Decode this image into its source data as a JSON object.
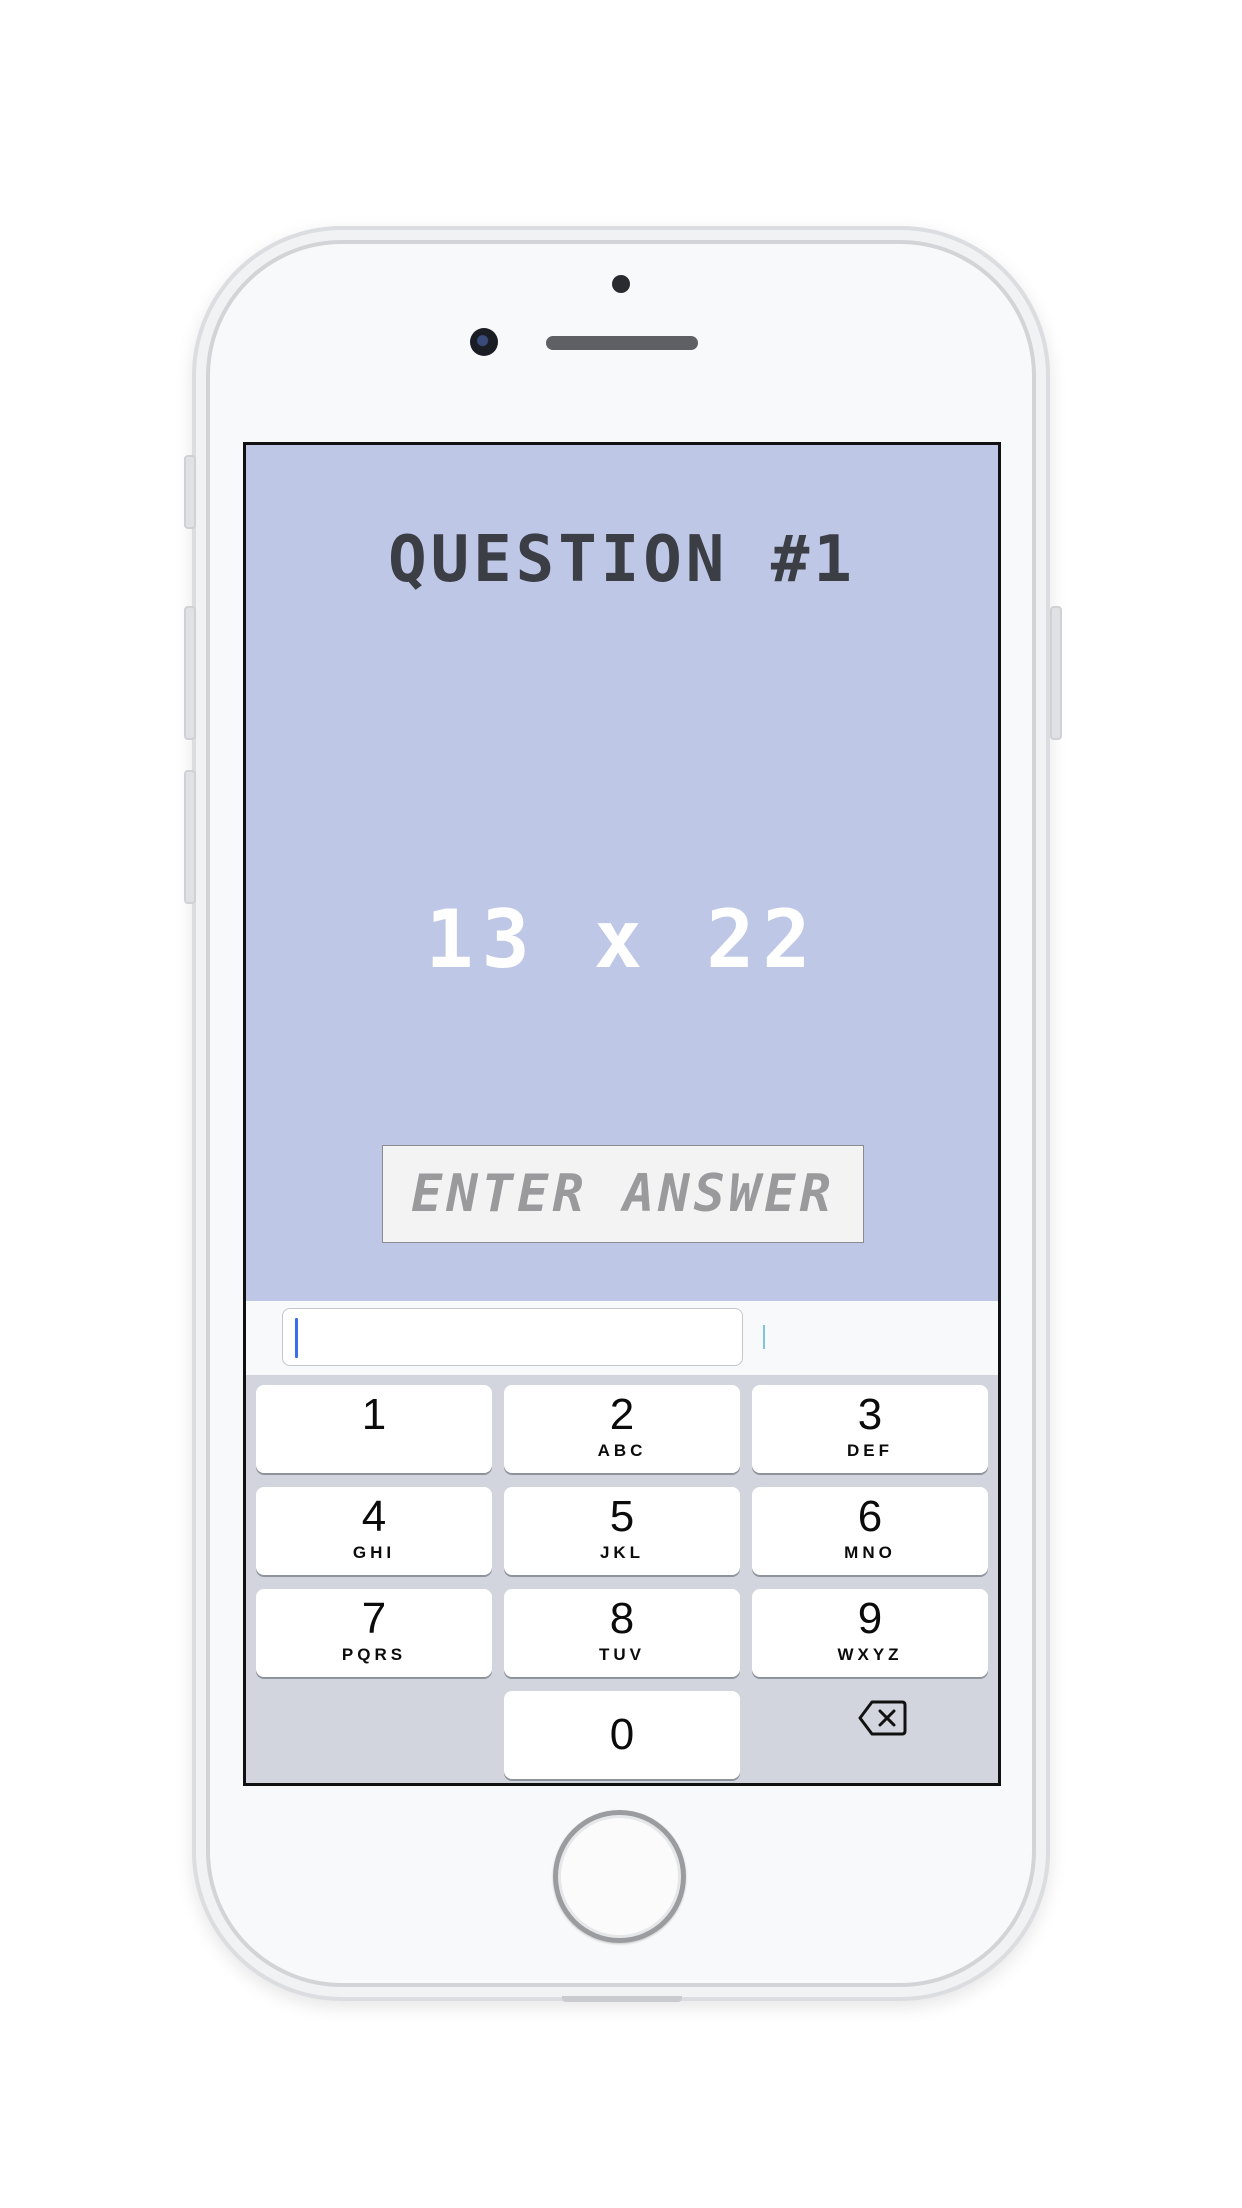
{
  "quiz": {
    "title": "QUESTION #1",
    "problem": "13 x 22",
    "answer_placeholder": "ENTER ANSWER"
  },
  "keypad": {
    "keys": [
      {
        "num": "1",
        "letters": ""
      },
      {
        "num": "2",
        "letters": "ABC"
      },
      {
        "num": "3",
        "letters": "DEF"
      },
      {
        "num": "4",
        "letters": "GHI"
      },
      {
        "num": "5",
        "letters": "JKL"
      },
      {
        "num": "6",
        "letters": "MNO"
      },
      {
        "num": "7",
        "letters": "PQRS"
      },
      {
        "num": "8",
        "letters": "TUV"
      },
      {
        "num": "9",
        "letters": "WXYZ"
      },
      {
        "num": "0",
        "letters": ""
      }
    ],
    "delete_icon": "backspace-icon"
  },
  "colors": {
    "screen_bg": "#bec7e6",
    "title_color": "#3c3e46",
    "problem_color": "#ffffff",
    "keypad_bg": "#d2d5dd",
    "caret": "#3b6ee8"
  }
}
